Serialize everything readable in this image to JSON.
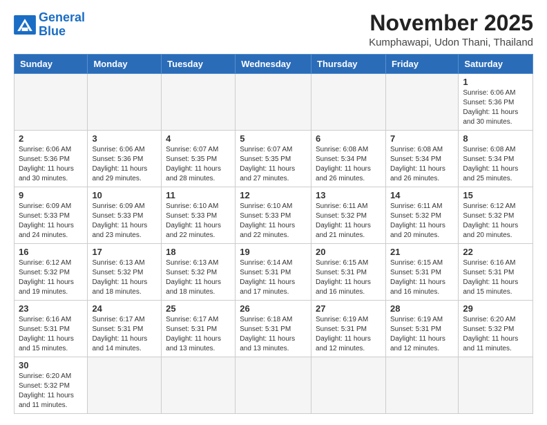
{
  "header": {
    "logo_general": "General",
    "logo_blue": "Blue",
    "month": "November 2025",
    "location": "Kumphawapi, Udon Thani, Thailand"
  },
  "days_of_week": [
    "Sunday",
    "Monday",
    "Tuesday",
    "Wednesday",
    "Thursday",
    "Friday",
    "Saturday"
  ],
  "weeks": [
    [
      {
        "day": "",
        "info": ""
      },
      {
        "day": "",
        "info": ""
      },
      {
        "day": "",
        "info": ""
      },
      {
        "day": "",
        "info": ""
      },
      {
        "day": "",
        "info": ""
      },
      {
        "day": "",
        "info": ""
      },
      {
        "day": "1",
        "info": "Sunrise: 6:06 AM\nSunset: 5:36 PM\nDaylight: 11 hours\nand 30 minutes."
      }
    ],
    [
      {
        "day": "2",
        "info": "Sunrise: 6:06 AM\nSunset: 5:36 PM\nDaylight: 11 hours\nand 30 minutes."
      },
      {
        "day": "3",
        "info": "Sunrise: 6:06 AM\nSunset: 5:36 PM\nDaylight: 11 hours\nand 29 minutes."
      },
      {
        "day": "4",
        "info": "Sunrise: 6:07 AM\nSunset: 5:35 PM\nDaylight: 11 hours\nand 28 minutes."
      },
      {
        "day": "5",
        "info": "Sunrise: 6:07 AM\nSunset: 5:35 PM\nDaylight: 11 hours\nand 27 minutes."
      },
      {
        "day": "6",
        "info": "Sunrise: 6:08 AM\nSunset: 5:34 PM\nDaylight: 11 hours\nand 26 minutes."
      },
      {
        "day": "7",
        "info": "Sunrise: 6:08 AM\nSunset: 5:34 PM\nDaylight: 11 hours\nand 26 minutes."
      },
      {
        "day": "8",
        "info": "Sunrise: 6:08 AM\nSunset: 5:34 PM\nDaylight: 11 hours\nand 25 minutes."
      }
    ],
    [
      {
        "day": "9",
        "info": "Sunrise: 6:09 AM\nSunset: 5:33 PM\nDaylight: 11 hours\nand 24 minutes."
      },
      {
        "day": "10",
        "info": "Sunrise: 6:09 AM\nSunset: 5:33 PM\nDaylight: 11 hours\nand 23 minutes."
      },
      {
        "day": "11",
        "info": "Sunrise: 6:10 AM\nSunset: 5:33 PM\nDaylight: 11 hours\nand 22 minutes."
      },
      {
        "day": "12",
        "info": "Sunrise: 6:10 AM\nSunset: 5:33 PM\nDaylight: 11 hours\nand 22 minutes."
      },
      {
        "day": "13",
        "info": "Sunrise: 6:11 AM\nSunset: 5:32 PM\nDaylight: 11 hours\nand 21 minutes."
      },
      {
        "day": "14",
        "info": "Sunrise: 6:11 AM\nSunset: 5:32 PM\nDaylight: 11 hours\nand 20 minutes."
      },
      {
        "day": "15",
        "info": "Sunrise: 6:12 AM\nSunset: 5:32 PM\nDaylight: 11 hours\nand 20 minutes."
      }
    ],
    [
      {
        "day": "16",
        "info": "Sunrise: 6:12 AM\nSunset: 5:32 PM\nDaylight: 11 hours\nand 19 minutes."
      },
      {
        "day": "17",
        "info": "Sunrise: 6:13 AM\nSunset: 5:32 PM\nDaylight: 11 hours\nand 18 minutes."
      },
      {
        "day": "18",
        "info": "Sunrise: 6:13 AM\nSunset: 5:32 PM\nDaylight: 11 hours\nand 18 minutes."
      },
      {
        "day": "19",
        "info": "Sunrise: 6:14 AM\nSunset: 5:31 PM\nDaylight: 11 hours\nand 17 minutes."
      },
      {
        "day": "20",
        "info": "Sunrise: 6:15 AM\nSunset: 5:31 PM\nDaylight: 11 hours\nand 16 minutes."
      },
      {
        "day": "21",
        "info": "Sunrise: 6:15 AM\nSunset: 5:31 PM\nDaylight: 11 hours\nand 16 minutes."
      },
      {
        "day": "22",
        "info": "Sunrise: 6:16 AM\nSunset: 5:31 PM\nDaylight: 11 hours\nand 15 minutes."
      }
    ],
    [
      {
        "day": "23",
        "info": "Sunrise: 6:16 AM\nSunset: 5:31 PM\nDaylight: 11 hours\nand 15 minutes."
      },
      {
        "day": "24",
        "info": "Sunrise: 6:17 AM\nSunset: 5:31 PM\nDaylight: 11 hours\nand 14 minutes."
      },
      {
        "day": "25",
        "info": "Sunrise: 6:17 AM\nSunset: 5:31 PM\nDaylight: 11 hours\nand 13 minutes."
      },
      {
        "day": "26",
        "info": "Sunrise: 6:18 AM\nSunset: 5:31 PM\nDaylight: 11 hours\nand 13 minutes."
      },
      {
        "day": "27",
        "info": "Sunrise: 6:19 AM\nSunset: 5:31 PM\nDaylight: 11 hours\nand 12 minutes."
      },
      {
        "day": "28",
        "info": "Sunrise: 6:19 AM\nSunset: 5:31 PM\nDaylight: 11 hours\nand 12 minutes."
      },
      {
        "day": "29",
        "info": "Sunrise: 6:20 AM\nSunset: 5:32 PM\nDaylight: 11 hours\nand 11 minutes."
      }
    ],
    [
      {
        "day": "30",
        "info": "Sunrise: 6:20 AM\nSunset: 5:32 PM\nDaylight: 11 hours\nand 11 minutes."
      },
      {
        "day": "",
        "info": ""
      },
      {
        "day": "",
        "info": ""
      },
      {
        "day": "",
        "info": ""
      },
      {
        "day": "",
        "info": ""
      },
      {
        "day": "",
        "info": ""
      },
      {
        "day": "",
        "info": ""
      }
    ]
  ]
}
